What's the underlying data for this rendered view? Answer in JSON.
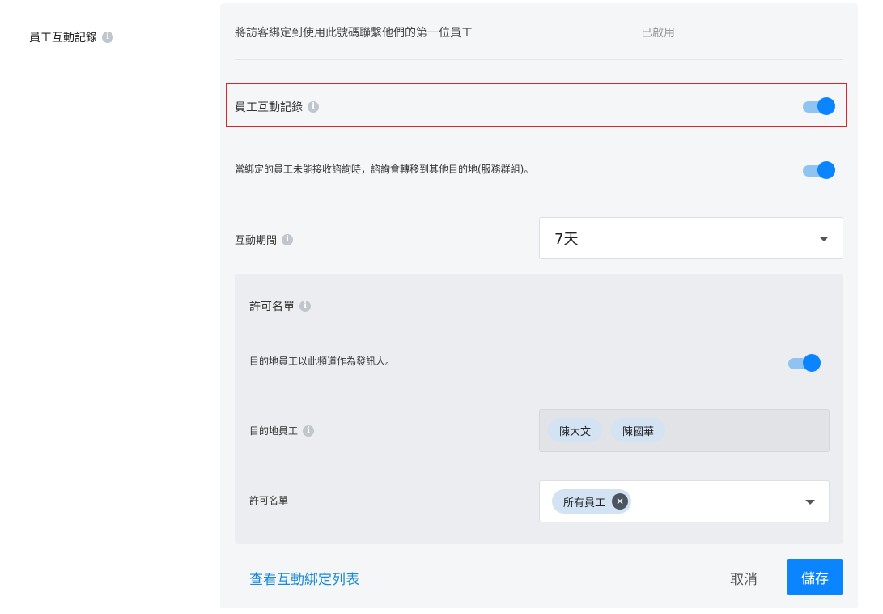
{
  "sidebar": {
    "title": "員工互動記錄",
    "info_icon": "info-icon"
  },
  "top": {
    "description": "將訪客綁定到使用此號碼聯繫他們的第一位員工",
    "status": "已啟用"
  },
  "staff_log": {
    "label": "員工互動記錄",
    "enabled": true
  },
  "fallback": {
    "label": "當綁定的員工未能接收諮詢時，諮詢會轉移到其他目的地(服務群組)。",
    "enabled": true
  },
  "duration": {
    "label": "互動期間",
    "value": "7天"
  },
  "allowlist": {
    "title": "許可名單",
    "sender_label": "目的地員工以此頻道作為發訊人。",
    "sender_enabled": true,
    "dest_label": "目的地員工",
    "dest_staff": [
      "陳大文",
      "陳國華"
    ],
    "list_label": "許可名單",
    "list_selected": "所有員工"
  },
  "footer": {
    "view_link": "查看互動綁定列表",
    "cancel_label": "取消",
    "save_label": "儲存"
  },
  "colors": {
    "accent": "#0a84ff",
    "highlight": "#d9242e",
    "link": "#1a8ad4"
  }
}
